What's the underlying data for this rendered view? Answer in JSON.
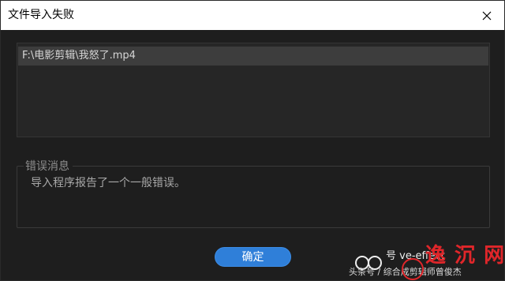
{
  "window": {
    "title": "文件导入失败",
    "close_icon": "close-icon"
  },
  "file_list": {
    "items": [
      {
        "path": "F:\\电影剪辑\\我怒了.mp4"
      }
    ]
  },
  "error_group": {
    "legend": "错误消息",
    "message": "导入程序报告了一个一般错误。"
  },
  "buttons": {
    "ok_label": "确定"
  },
  "watermark": {
    "line1": "号 ve-effect",
    "line2": "头条号 / 综合成剪辑师曾俊杰",
    "brand": "逸 沉 网",
    "brand_color": "#e0262a"
  },
  "colors": {
    "dialog_bg": "#1e1e1e",
    "accent": "#2f7fd9",
    "selection": "#3d3d3d"
  }
}
